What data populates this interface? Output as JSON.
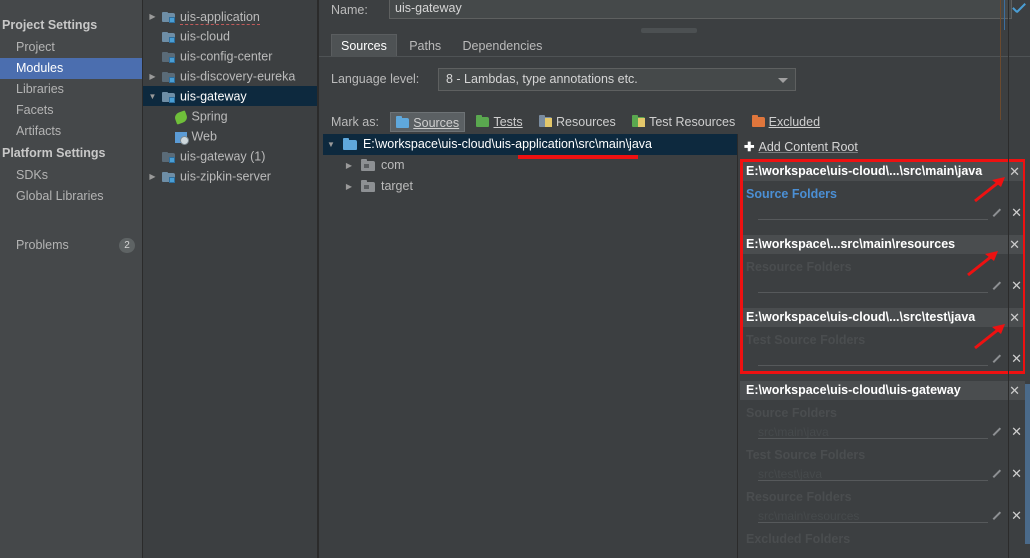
{
  "sidebar": {
    "groups": [
      {
        "title": "Project Settings",
        "items": [
          {
            "label": "Project",
            "selected": false
          },
          {
            "label": "Modules",
            "selected": true
          },
          {
            "label": "Libraries",
            "selected": false
          },
          {
            "label": "Facets",
            "selected": false
          },
          {
            "label": "Artifacts",
            "selected": false
          }
        ]
      },
      {
        "title": "Platform Settings",
        "items": [
          {
            "label": "SDKs",
            "selected": false
          },
          {
            "label": "Global Libraries",
            "selected": false
          }
        ]
      }
    ],
    "problems": {
      "label": "Problems",
      "count": "2"
    }
  },
  "module_tree": {
    "items": [
      {
        "label": "uis-application",
        "arrow": "collapsed",
        "icon": "module-folder-icon",
        "indent": 0,
        "selected": false,
        "error": true
      },
      {
        "label": "uis-cloud",
        "arrow": "none",
        "icon": "module-folder-icon",
        "indent": 0,
        "selected": false,
        "error": false
      },
      {
        "label": "uis-config-center",
        "arrow": "none",
        "icon": "module-folder-icon",
        "indent": 0,
        "selected": false,
        "error": false
      },
      {
        "label": "uis-discovery-eureka",
        "arrow": "collapsed",
        "icon": "module-folder-icon",
        "indent": 0,
        "selected": false,
        "error": false
      },
      {
        "label": "uis-gateway",
        "arrow": "expanded",
        "icon": "module-folder-icon",
        "indent": 0,
        "selected": true,
        "error": false
      },
      {
        "label": "Spring",
        "arrow": "none",
        "icon": "spring-leaf-icon",
        "indent": 1,
        "selected": false,
        "error": false
      },
      {
        "label": "Web",
        "arrow": "none",
        "icon": "web-facet-icon",
        "indent": 1,
        "selected": false,
        "error": false
      },
      {
        "label": "uis-gateway (1)",
        "arrow": "none",
        "icon": "module-folder-icon",
        "indent": 0,
        "selected": false,
        "error": false
      },
      {
        "label": "uis-zipkin-server",
        "arrow": "collapsed",
        "icon": "module-folder-icon",
        "indent": 0,
        "selected": false,
        "error": false
      }
    ]
  },
  "main": {
    "name_label": "Name:",
    "name_value": "uis-gateway",
    "name_placeholder": "",
    "tabs": [
      {
        "label": "Sources",
        "active": true
      },
      {
        "label": "Paths",
        "active": false
      },
      {
        "label": "Dependencies",
        "active": false
      }
    ],
    "language_level_label": "Language level:",
    "language_level_value": "8 - Lambdas, type annotations etc.",
    "mark_as_label": "Mark as:",
    "mark_buttons": [
      {
        "label": "Sources",
        "icon": "sources-folder-icon",
        "pressed": true
      },
      {
        "label": "Tests",
        "icon": "tests-folder-icon",
        "pressed": false
      },
      {
        "label": "Resources",
        "icon": "resources-folder-icon",
        "pressed": false
      },
      {
        "label": "Test Resources",
        "icon": "test-resources-folder-icon",
        "pressed": false
      },
      {
        "label": "Excluded",
        "icon": "excluded-folder-icon",
        "pressed": false
      }
    ],
    "content_tree": [
      {
        "label": "E:\\workspace\\uis-cloud\\uis-application\\src\\main\\java",
        "arrow": "expanded",
        "icon": "source-folder-icon",
        "indent": 0,
        "selected": true
      },
      {
        "label": "com",
        "arrow": "collapsed",
        "icon": "plain-folder-icon",
        "indent": 1,
        "selected": false
      },
      {
        "label": "target",
        "arrow": "collapsed",
        "icon": "plain-folder-icon",
        "indent": 1,
        "selected": false
      }
    ]
  },
  "right_panel": {
    "add_content_root": "Add Content Root",
    "add_icon": "plus-icon",
    "roots": [
      {
        "path": "E:\\workspace\\uis-cloud\\...\\src\\main\\java",
        "close_icon": "close-icon",
        "sections": [
          {
            "title": "Source Folders",
            "style": "blue",
            "folders": [
              {
                "path": "",
                "edit_icon": "pencil-icon",
                "remove_icon": "close-icon"
              }
            ]
          }
        ]
      },
      {
        "path": "E:\\workspace\\...src\\main\\resources",
        "close_icon": "close-icon",
        "sections": [
          {
            "title": "Resource Folders",
            "style": "dim",
            "folders": [
              {
                "path": "",
                "edit_icon": "pencil-icon",
                "remove_icon": "close-icon"
              }
            ]
          }
        ]
      },
      {
        "path": "E:\\workspace\\uis-cloud\\...\\src\\test\\java",
        "close_icon": "close-icon",
        "sections": [
          {
            "title": "Test Source Folders",
            "style": "dim",
            "folders": [
              {
                "path": "",
                "edit_icon": "pencil-icon",
                "remove_icon": "close-icon"
              }
            ]
          }
        ]
      },
      {
        "path": "E:\\workspace\\uis-cloud\\uis-gateway",
        "close_icon": "close-icon",
        "sections": [
          {
            "title": "Source Folders",
            "style": "dim",
            "folders": [
              {
                "path": "src\\main\\java",
                "edit_icon": "pencil-icon",
                "remove_icon": "close-icon"
              }
            ]
          },
          {
            "title": "Test Source Folders",
            "style": "dim",
            "folders": [
              {
                "path": "src\\test\\java",
                "edit_icon": "pencil-icon",
                "remove_icon": "close-icon"
              }
            ]
          },
          {
            "title": "Resource Folders",
            "style": "dim",
            "folders": [
              {
                "path": "src\\main\\resources",
                "edit_icon": "pencil-icon",
                "remove_icon": "close-icon"
              }
            ]
          },
          {
            "title": "Excluded Folders",
            "style": "dim",
            "folders": []
          }
        ]
      }
    ]
  },
  "annotations": {
    "red_box": true,
    "red_underline": true,
    "red_arrows": 3
  },
  "colors": {
    "background": "#3c3f41",
    "sidebar_background": "#45484a",
    "selection_blue": "#4b6eaf",
    "tree_selection": "#0d293e",
    "link_blue": "#4b8fd4",
    "annotation_red": "#ee1111",
    "accent_check": "#4a9ed4"
  }
}
